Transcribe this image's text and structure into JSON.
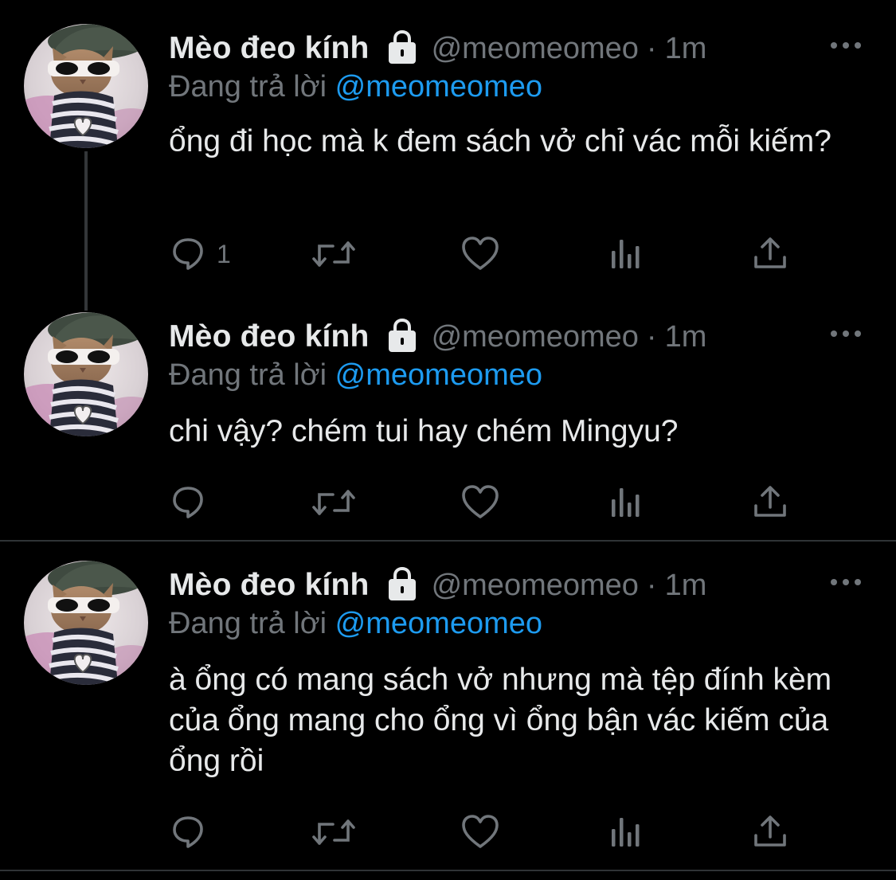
{
  "tweets": [
    {
      "display_name": "Mèo đeo kính",
      "handle": "@meomeomeo",
      "separator": "·",
      "time": "1m",
      "replying_prefix": "Đang trả lời",
      "replying_to": "@meomeomeo",
      "text": "ổng đi học mà k đem sách vở chỉ vác mỗi kiếm?",
      "reply_count": "1"
    },
    {
      "display_name": "Mèo đeo kính",
      "handle": "@meomeomeo",
      "separator": "·",
      "time": "1m",
      "replying_prefix": "Đang trả lời",
      "replying_to": "@meomeomeo",
      "text": "chi vậy? chém tui hay chém Mingyu?",
      "reply_count": ""
    },
    {
      "display_name": "Mèo đeo kính",
      "handle": "@meomeomeo",
      "separator": "·",
      "time": "1m",
      "replying_prefix": "Đang trả lời",
      "replying_to": "@meomeomeo",
      "text": "à ổng có mang sách vở nhưng mà tệp đính kèm của ổng mang cho ổng vì ổng bận vác kiếm của ổng rồi",
      "reply_count": ""
    }
  ],
  "icons": {
    "lock": "lock-icon",
    "more": "more-icon",
    "reply": "reply-icon",
    "retweet": "retweet-icon",
    "like": "like-icon",
    "views": "views-icon",
    "share": "share-icon"
  },
  "colors": {
    "background": "#000000",
    "text": "#e7e9ea",
    "secondary": "#71767b",
    "mention": "#1d9bf0",
    "divider": "#2f3336"
  }
}
